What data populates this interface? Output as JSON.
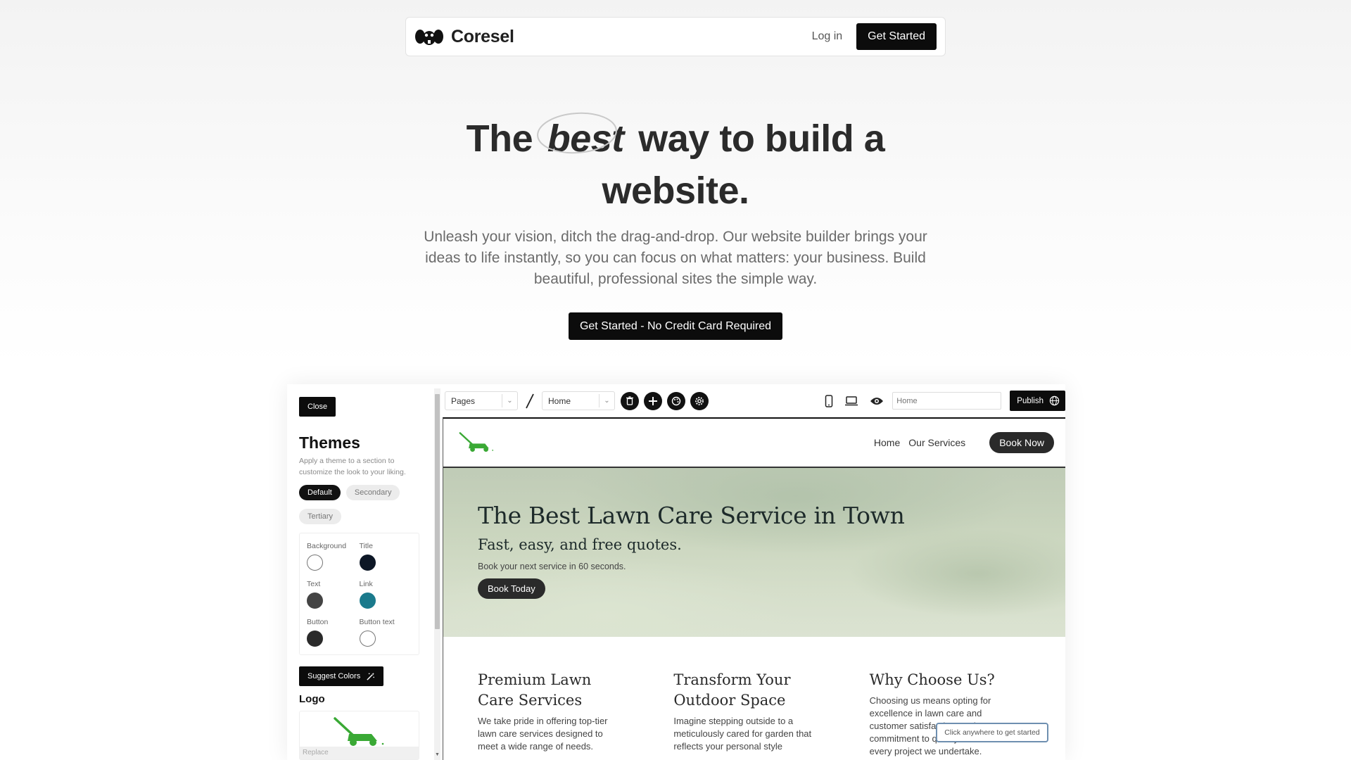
{
  "nav": {
    "brand": "Coresel",
    "login": "Log in",
    "cta": "Get Started"
  },
  "hero": {
    "title_before": "The",
    "title_emphasis": "best",
    "title_after": "way to build a",
    "title_line2": "website.",
    "subtitle": "Unleash your vision, ditch the drag-and-drop. Our website builder brings your ideas to life instantly, so you can focus on what matters: your business. Build beautiful, professional sites the simple way.",
    "cta": "Get Started - No Credit Card Required"
  },
  "panel": {
    "close": "Close",
    "title": "Themes",
    "help": "Apply a theme to a section to customize the look to your liking.",
    "themes": [
      "Default",
      "Secondary",
      "Tertiary"
    ],
    "active_theme": "Default",
    "colors": [
      {
        "label": "Background",
        "value": "#ffffff"
      },
      {
        "label": "Title",
        "value": "#0d1726"
      },
      {
        "label": "Text",
        "value": "#444444"
      },
      {
        "label": "Link",
        "value": "#1a7a8c"
      },
      {
        "label": "Button",
        "value": "#2a2a2a"
      },
      {
        "label": "Button text",
        "value": "#ffffff"
      }
    ],
    "suggest": "Suggest Colors",
    "logo_heading": "Logo",
    "replace": "Replace"
  },
  "toolbar": {
    "pages_select": "Pages",
    "page_select": "Home",
    "url_placeholder": "Home",
    "publish": "Publish"
  },
  "site": {
    "nav_links": [
      "Home",
      "Our Services"
    ],
    "book_now": "Book Now",
    "hero_title": "The Best Lawn Care Service in Town",
    "hero_subtitle": "Fast, easy, and free quotes.",
    "hero_text": "Book your next service in 60 seconds.",
    "hero_button": "Book Today",
    "features": [
      {
        "title": "Premium Lawn Care Services",
        "text": "We take pride in offering top-tier lawn care services designed to meet a wide range of needs."
      },
      {
        "title": "Transform Your Outdoor Space",
        "text": "Imagine stepping outside to a meticulously cared for garden that reflects your personal style"
      },
      {
        "title": "Why Choose Us?",
        "text": "Choosing us means opting for excellence in lawn care and customer satisfaction, and a commitment to quality evident in every project we undertake."
      }
    ]
  },
  "tooltip": "Click anywhere to get started",
  "colors": {
    "accent": "#0c0c0c",
    "logo_green": "#3aa935"
  }
}
